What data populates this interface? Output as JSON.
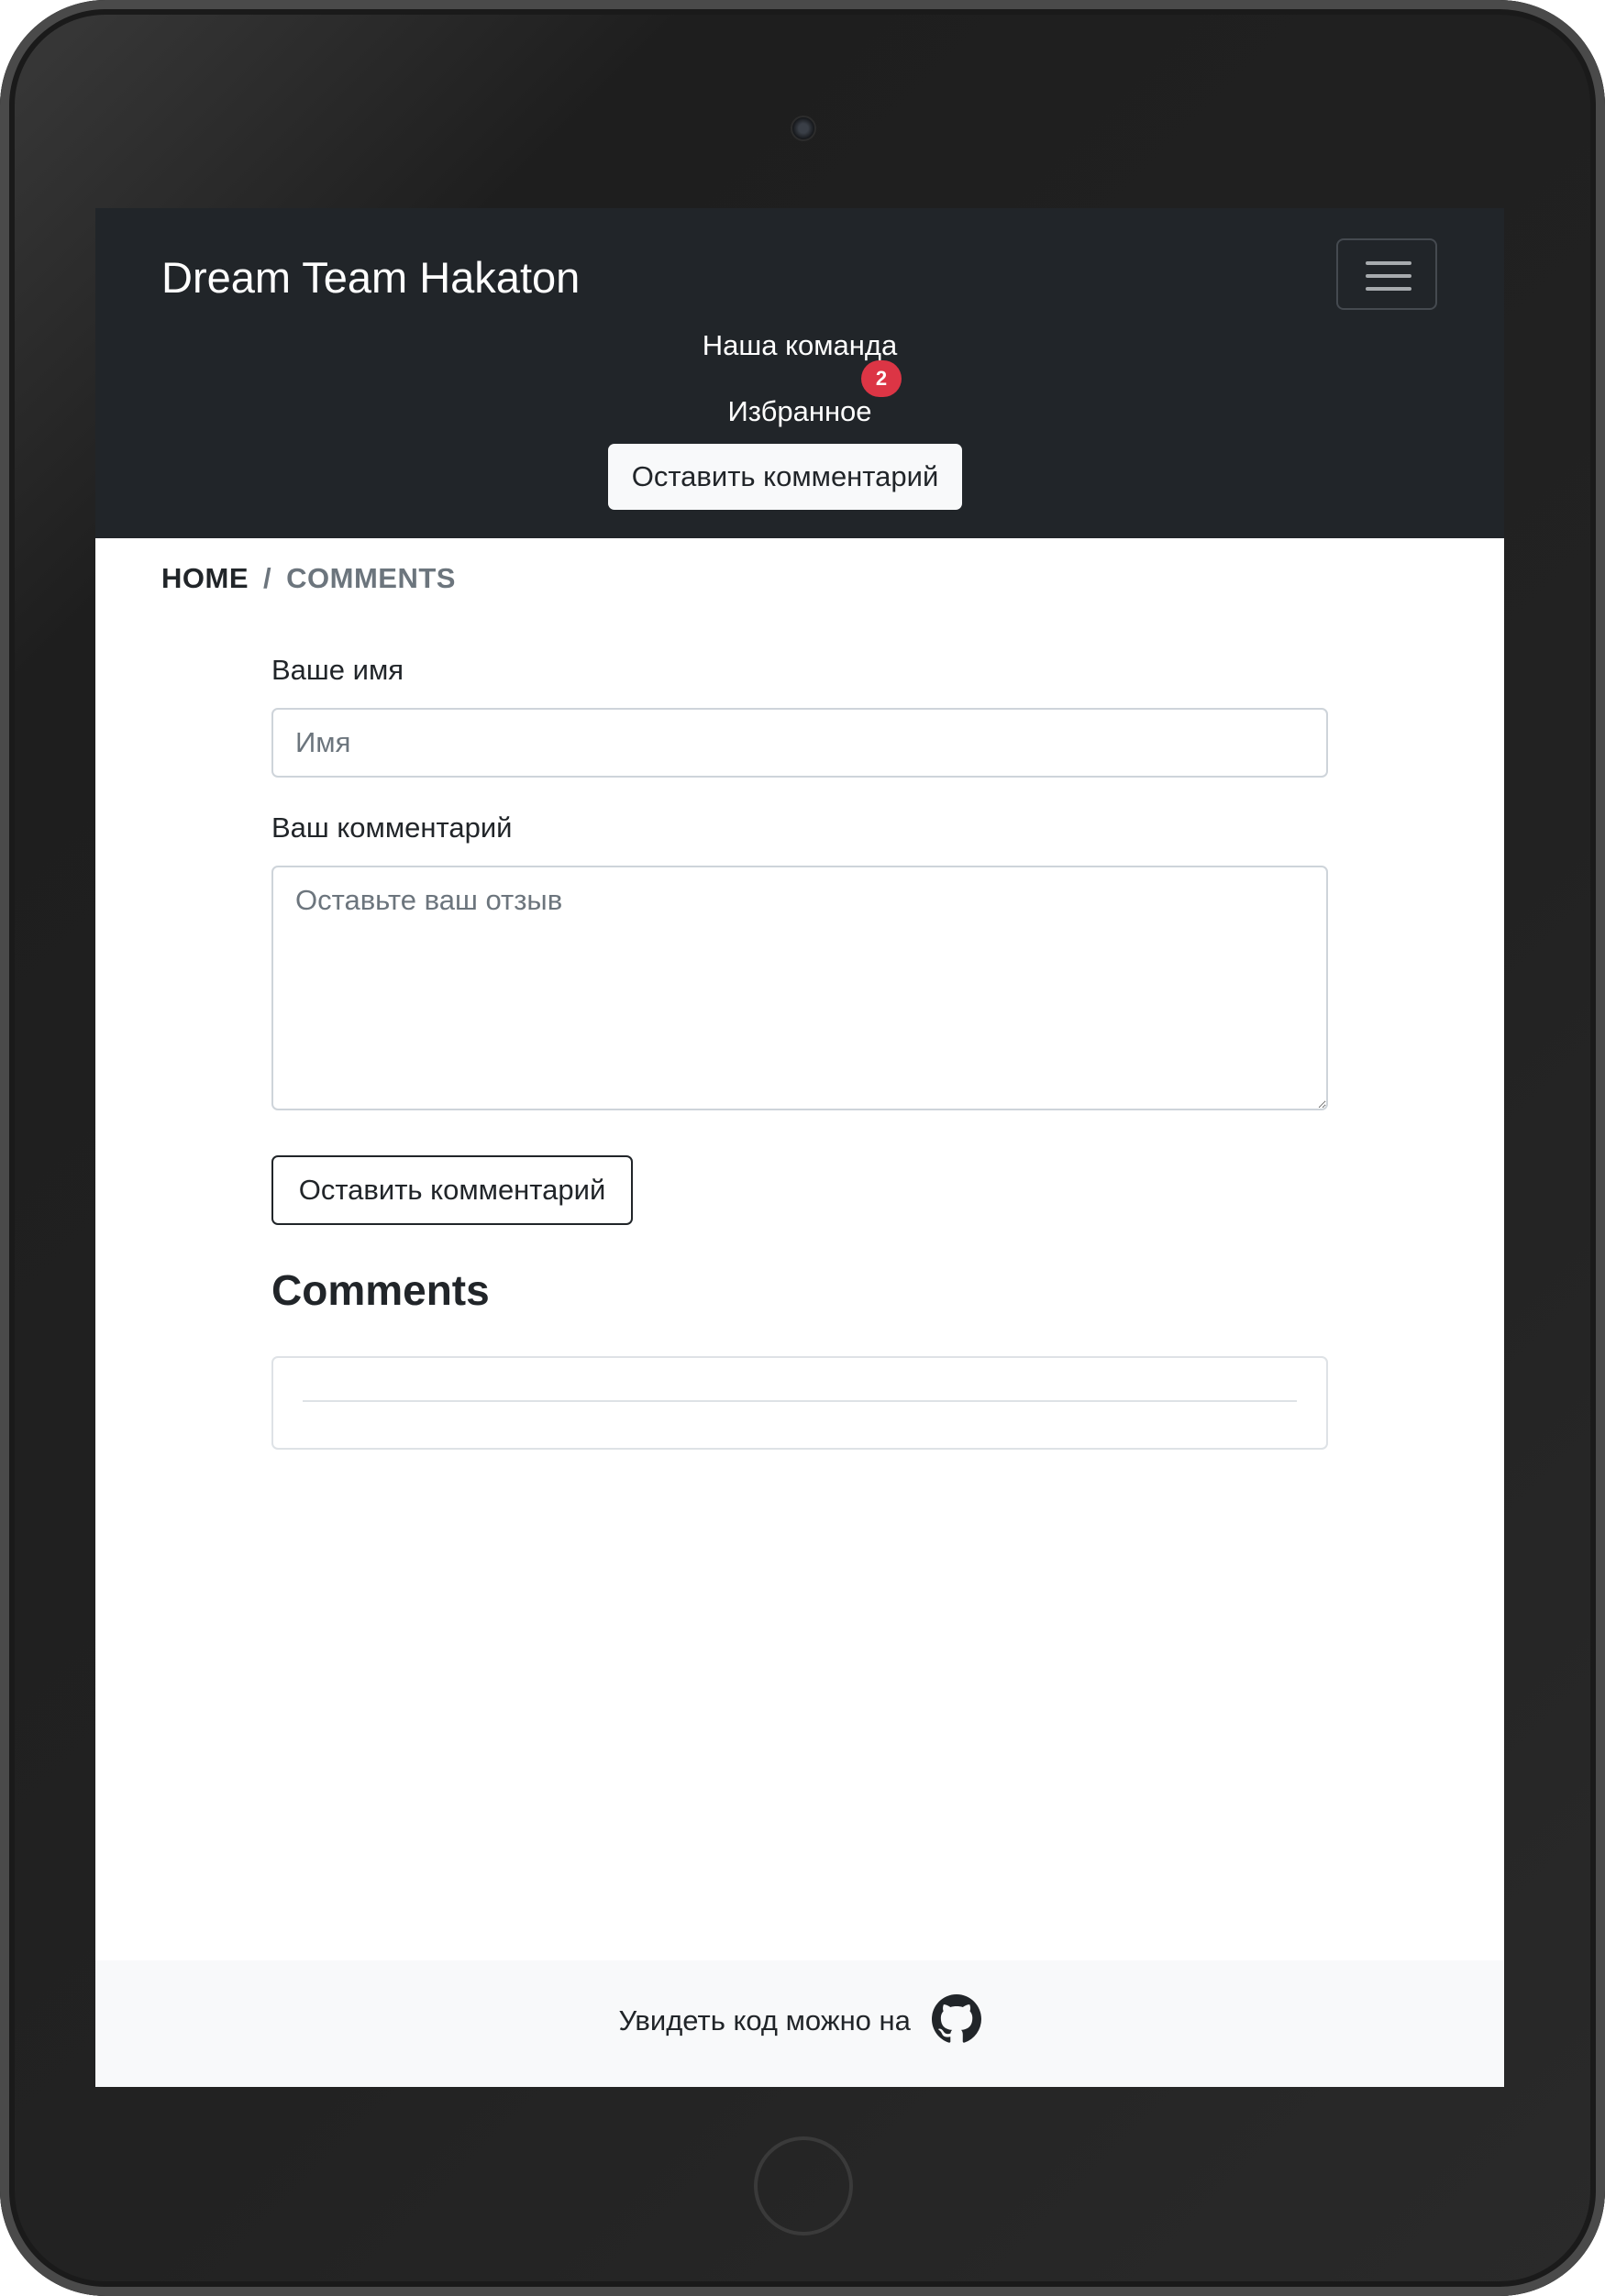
{
  "navbar": {
    "brand": "Dream Team Hakaton",
    "links": [
      {
        "label": "Наша команда"
      },
      {
        "label": "Избранное",
        "badge": "2"
      }
    ],
    "cta_label": "Оставить комментарий",
    "toggler_icon": "hamburger-menu-icon"
  },
  "breadcrumb": {
    "home": "HOME",
    "separator": "/",
    "current": "COMMENTS"
  },
  "form": {
    "name_label": "Ваше имя",
    "name_placeholder": "Имя",
    "name_value": "",
    "comment_label": "Ваш комментарий",
    "comment_placeholder": "Оставьте ваш отзыв",
    "comment_value": "",
    "submit_label": "Оставить комментарий"
  },
  "comments": {
    "title": "Comments",
    "items": []
  },
  "footer": {
    "text": "Увидеть код можно на",
    "icon": "github-icon"
  },
  "colors": {
    "navbar_bg": "#212529",
    "badge_bg": "#dc3545",
    "footer_bg": "#f8f9fa",
    "muted": "#6c757d"
  }
}
